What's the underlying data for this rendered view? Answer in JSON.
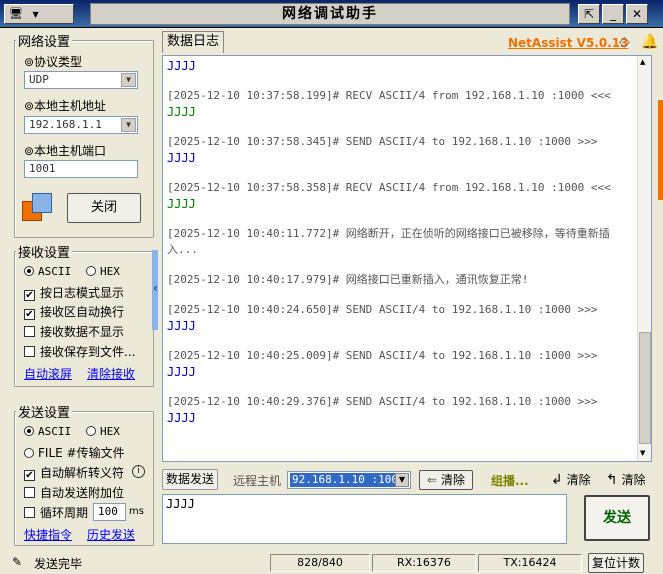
{
  "app": {
    "title": "网络调试助手",
    "brand": "NetAssist V5.0.13",
    "sys_menu_arrow": "▼"
  },
  "network": {
    "group_title": "网络设置",
    "protocol_label": "⊚协议类型",
    "protocol_value": "UDP",
    "host_label": "⊚本地主机地址",
    "host_value": "192.168.1.1",
    "port_label": "⊚本地主机端口",
    "port_value": "1001",
    "close_button": "关闭"
  },
  "receive": {
    "group_title": "接收设置",
    "ascii": "ASCII",
    "hex": "HEX",
    "opt_log_mode": "按日志模式显示",
    "opt_auto_wrap": "接收区自动换行",
    "opt_hide": "接收数据不显示",
    "opt_save_file": "接收保存到文件...",
    "auto_scroll": "自动滚屏",
    "clear_recv": "清除接收"
  },
  "send": {
    "group_title": "发送设置",
    "ascii": "ASCII",
    "hex": "HEX",
    "file_source": "FILE #传输文件",
    "opt_escape": "自动解析转义符",
    "opt_append": "自动发送附加位",
    "opt_loop": "循环周期",
    "loop_value": "100",
    "loop_unit": "ms",
    "shortcuts": "快捷指令",
    "history": "历史发送"
  },
  "log": {
    "tab_label": "数据日志",
    "top_partial": "JJJJ",
    "entries": [
      {
        "header": "[2025-12-10 10:37:58.199]# RECV ASCII/4 from 192.168.1.10 :1000 <<<",
        "data": "JJJJ",
        "kind": "recv"
      },
      {
        "header": "[2025-12-10 10:37:58.345]# SEND ASCII/4 to 192.168.1.10 :1000 >>>",
        "data": "JJJJ",
        "kind": "sent"
      },
      {
        "header": "[2025-12-10 10:37:58.358]# RECV ASCII/4 from 192.168.1.10 :1000 <<<",
        "data": "JJJJ",
        "kind": "recv"
      },
      {
        "header": "[2025-12-10 10:40:11.772]# 网络断开，正在侦听的网络接口已被移除，等待重新插入...",
        "data": "",
        "kind": "info"
      },
      {
        "header": "[2025-12-10 10:40:17.979]# 网络接口已重新插入，通讯恢复正常!",
        "data": "",
        "kind": "info"
      },
      {
        "header": "[2025-12-10 10:40:24.650]# SEND ASCII/4 to 192.168.1.10 :1000 >>>",
        "data": "JJJJ",
        "kind": "sent"
      },
      {
        "header": "[2025-12-10 10:40:25.009]# SEND ASCII/4 to 192.168.1.10 :1000 >>>",
        "data": "JJJJ",
        "kind": "sent"
      },
      {
        "header": "[2025-12-10 10:40:29.376]# SEND ASCII/4 to 192.168.1.10 :1000 >>>",
        "data": "JJJJ",
        "kind": "sent"
      }
    ]
  },
  "sendbar": {
    "tab_label": "数据发送",
    "remote_label": "远程主机",
    "remote_value": "92.168.1.10 :1000",
    "clear1": "清除",
    "group_label": "组播...",
    "clear2": "清除",
    "clear3": "清除",
    "send_text": "JJJJ",
    "send_button": "发送"
  },
  "status": {
    "text": "发送完毕",
    "count": "828/840",
    "rx": "RX:16376",
    "tx": "TX:16424",
    "reset": "复位计数"
  },
  "colors": {
    "sent": "#0000c0",
    "recv": "#008000",
    "brand": "#f07000",
    "link": "#0000ff"
  }
}
